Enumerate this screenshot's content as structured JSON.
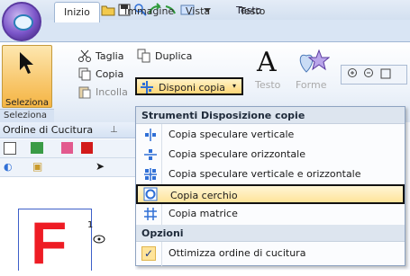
{
  "window": {
    "title": "Testo"
  },
  "tabs": [
    "Inizio",
    "Immagine",
    "Vista",
    "Testo"
  ],
  "ribbon": {
    "seleziona_label": "Seleziona",
    "seleziona_group": "Seleziona",
    "taglia": "Taglia",
    "copia": "Copia",
    "incolla": "Incolla",
    "duplica": "Duplica",
    "disponi_copia": "Disponi copia",
    "testo": "Testo",
    "forme": "Forme"
  },
  "panel": {
    "title": "Ordine di Cucitura",
    "pin": "⩮",
    "design_letter": "F",
    "design_number": "1"
  },
  "menu": {
    "section1": "Strumenti Disposizione copie",
    "items": [
      "Copia speculare verticale",
      "Copia speculare orizzontale",
      "Copia speculare verticale e orizzontale",
      "Copia cerchio",
      "Copia matrice"
    ],
    "section2": "Opzioni",
    "option": "Ottimizza ordine di cucitura",
    "check": "✓"
  },
  "colors": {
    "accent": "#ffd676",
    "red": "#ee1c24",
    "blue": "#2f6fd6"
  }
}
